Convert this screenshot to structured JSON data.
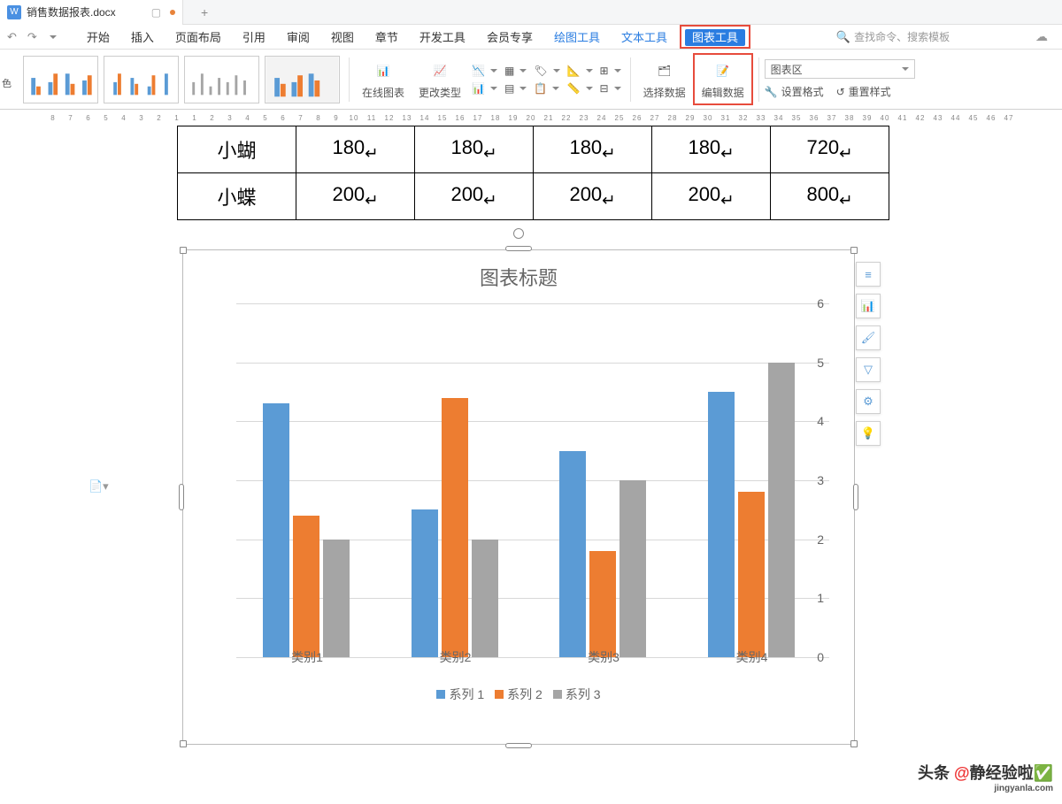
{
  "titlebar": {
    "doc_name": "销售数据报表.docx",
    "doc_icon": "W"
  },
  "ribbon": {
    "tabs": [
      "开始",
      "插入",
      "页面布局",
      "引用",
      "审阅",
      "视图",
      "章节",
      "开发工具",
      "会员专享"
    ],
    "context_tabs": [
      "绘图工具",
      "文本工具",
      "图表工具"
    ],
    "search_placeholder": "查找命令、搜索模板"
  },
  "toolbar": {
    "left_label": "色",
    "online_chart": "在线图表",
    "change_type": "更改类型",
    "select_data": "选择数据",
    "edit_data": "编辑数据",
    "area_select": "图表区",
    "set_format": "设置格式",
    "reset_style": "重置样式"
  },
  "ruler_ticks": [
    8,
    7,
    6,
    5,
    4,
    3,
    2,
    1,
    1,
    2,
    3,
    4,
    5,
    6,
    7,
    8,
    9,
    10,
    11,
    12,
    13,
    14,
    15,
    16,
    17,
    18,
    19,
    20,
    21,
    22,
    23,
    24,
    25,
    26,
    27,
    28,
    29,
    30,
    31,
    32,
    33,
    34,
    35,
    36,
    37,
    38,
    39,
    40,
    41,
    42,
    43,
    44,
    45,
    46,
    47
  ],
  "table": {
    "rows": [
      {
        "name": "小蝴",
        "c1": "180",
        "c2": "180",
        "c3": "180",
        "c4": "180",
        "c5": "720"
      },
      {
        "name": "小蝶",
        "c1": "200",
        "c2": "200",
        "c3": "200",
        "c4": "200",
        "c5": "800"
      }
    ]
  },
  "chart_data": {
    "type": "bar",
    "title": "图表标题",
    "categories": [
      "类别1",
      "类别2",
      "类别3",
      "类别4"
    ],
    "series": [
      {
        "name": "系列 1",
        "values": [
          4.3,
          2.5,
          3.5,
          4.5
        ],
        "color": "#5b9bd5"
      },
      {
        "name": "系列 2",
        "values": [
          2.4,
          4.4,
          1.8,
          2.8
        ],
        "color": "#ed7d31"
      },
      {
        "name": "系列 3",
        "values": [
          2.0,
          2.0,
          3.0,
          5.0
        ],
        "color": "#a5a5a5"
      }
    ],
    "y_ticks": [
      0,
      1,
      2,
      3,
      4,
      5,
      6
    ],
    "ylim": [
      0,
      6
    ]
  },
  "watermark": {
    "prefix": "头条 ",
    "at": "@",
    "name": "静经验啦",
    "site": "jingyanla.com"
  }
}
